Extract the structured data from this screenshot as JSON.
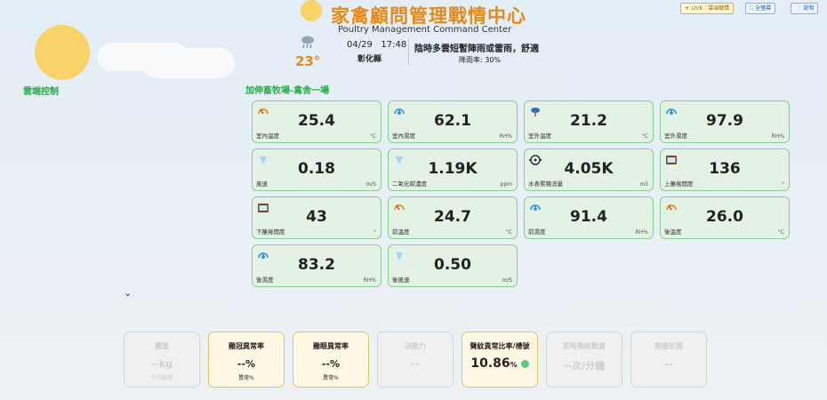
{
  "header": {
    "title_cn": "家禽顧問管理戰情中心",
    "title_en": "Poultry Management Command Center",
    "buttons": [
      {
        "label": "☀ LIVE｜雲端戰情",
        "icon": "live-icon"
      },
      {
        "label": "⛶ 全螢幕",
        "icon": "fullscreen-icon"
      },
      {
        "label": "❔ 說明",
        "icon": "help-icon"
      }
    ]
  },
  "weather": {
    "temp": "23°",
    "date": "04/29",
    "time": "17:48",
    "location": "彰化縣",
    "forecast": "陰時多雲短暫陣雨或雷雨，舒適",
    "rain": "降雨率: 30%",
    "icon": "cloud-rain-icon"
  },
  "sidebar": {
    "label": "雲端控制"
  },
  "farm": {
    "title": "加伸畜牧場-禽舍一場"
  },
  "sensors": [
    {
      "value": "25.4",
      "label": "室內溫度",
      "unit": "°C",
      "icon": "thermometer-icon"
    },
    {
      "value": "62.1",
      "label": "室內濕度",
      "unit": "RH%",
      "icon": "humidity-icon"
    },
    {
      "value": "21.2",
      "label": "室外溫度",
      "unit": "°C",
      "icon": "outdoor-temp-icon"
    },
    {
      "value": "97.9",
      "label": "室外濕度",
      "unit": "RH%",
      "icon": "outdoor-humidity-icon"
    },
    {
      "value": "0.18",
      "label": "風速",
      "unit": "m/S",
      "icon": "wind-icon"
    },
    {
      "value": "1.19K",
      "label": "二氧化碳濃度",
      "unit": "ppm",
      "icon": "co2-icon"
    },
    {
      "value": "4.05K",
      "label": "水表累積流量",
      "unit": "m3",
      "icon": "water-meter-icon"
    },
    {
      "value": "136",
      "label": "上簾捲開度",
      "unit": "°",
      "icon": "curtain-icon"
    },
    {
      "value": "43",
      "label": "下簾捲開度",
      "unit": "°",
      "icon": "curtain-icon"
    },
    {
      "value": "24.7",
      "label": "前溫度",
      "unit": "°C",
      "icon": "thermometer-icon"
    },
    {
      "value": "91.4",
      "label": "前濕度",
      "unit": "RH%",
      "icon": "humidity-icon"
    },
    {
      "value": "26.0",
      "label": "後溫度",
      "unit": "°C",
      "icon": "thermometer-icon"
    },
    {
      "value": "83.2",
      "label": "後濕度",
      "unit": "RH%",
      "icon": "humidity-icon"
    },
    {
      "value": "0.50",
      "label": "後風速",
      "unit": "m/S",
      "icon": "wind-icon"
    }
  ],
  "cards": [
    {
      "title": "體重",
      "value": "--kg",
      "sub": "平均體重",
      "active": false
    },
    {
      "title": "雞冠異常率",
      "value": "--%",
      "sub": "異常%",
      "active": true
    },
    {
      "title": "雞眼異常率",
      "value": "--%",
      "sub": "異常%",
      "active": true
    },
    {
      "title": "活動力",
      "value": "--",
      "sub": "",
      "active": false
    },
    {
      "title": "聲紋異常比率/禮號",
      "value": "10.86",
      "unit": "%",
      "sub": "",
      "active": true,
      "status_color": "#5cc87a"
    },
    {
      "title": "即時聲紋數量",
      "value": "--次/分鐘",
      "sub": "",
      "active": false
    },
    {
      "title": "飼養狀態",
      "value": "--",
      "sub": "...",
      "active": false
    }
  ]
}
